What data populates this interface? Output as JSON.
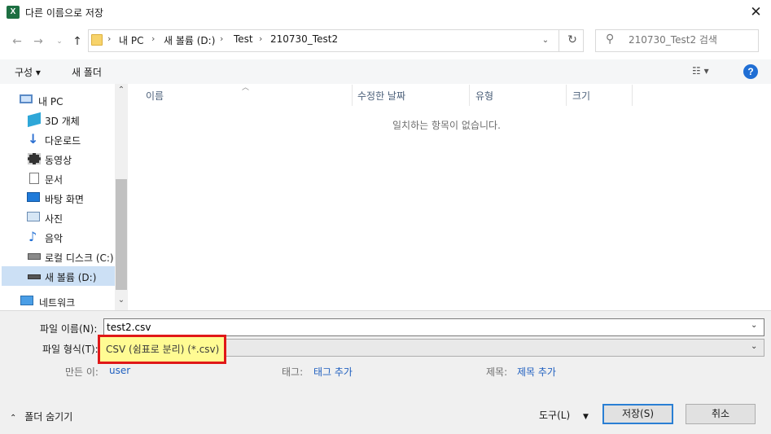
{
  "window": {
    "title": "다른 이름으로 저장",
    "app_icon": "X",
    "close_glyph": "✕"
  },
  "address": {
    "segments": [
      "내 PC",
      "새 볼륨 (D:)",
      "Test",
      "210730_Test2"
    ]
  },
  "search": {
    "placeholder": "210730_Test2 검색"
  },
  "toolbar": {
    "organize_label": "구성 ▾",
    "new_folder_label": "새 폴더",
    "view_label": "☷ ▾",
    "help_label": "?"
  },
  "nav": {
    "items": [
      {
        "label": "내 PC",
        "icon": "computer-icon",
        "selected": false
      },
      {
        "label": "3D 개체",
        "icon": "3d-objects-icon",
        "selected": false
      },
      {
        "label": "다운로드",
        "icon": "download-icon",
        "selected": false
      },
      {
        "label": "동영상",
        "icon": "video-icon",
        "selected": false
      },
      {
        "label": "문서",
        "icon": "document-icon",
        "selected": false
      },
      {
        "label": "바탕 화면",
        "icon": "desktop-icon",
        "selected": false
      },
      {
        "label": "사진",
        "icon": "picture-icon",
        "selected": false
      },
      {
        "label": "음악",
        "icon": "music-icon",
        "selected": false
      },
      {
        "label": "로컬 디스크 (C:)",
        "icon": "drive-icon",
        "selected": false
      },
      {
        "label": "새 볼륨 (D:)",
        "icon": "drive-icon",
        "selected": true
      },
      {
        "label": "네트워크",
        "icon": "network-icon",
        "selected": false
      }
    ]
  },
  "file_list": {
    "columns": [
      "이름",
      "수정한 날짜",
      "유형",
      "크기"
    ],
    "empty_message": "일치하는 항목이 없습니다."
  },
  "form": {
    "filename_label": "파일 이름(N):",
    "filename_value": "test2.csv",
    "filetype_label": "파일 형식(T):",
    "filetype_value": "CSV (쉼표로 분리) (*.csv)",
    "author_label": "만든 이:",
    "author_value": "user",
    "tags_label": "태그:",
    "tags_value": "태그 추가",
    "title_label": "제목:",
    "title_value": "제목 추가"
  },
  "footer": {
    "hide_folders_label": "폴더 숨기기",
    "tools_label": "도구(L)",
    "save_label": "저장(S)",
    "cancel_label": "취소"
  },
  "colors": {
    "highlight_border": "#e01818",
    "highlight_fill": "#fffb93",
    "accent": "#2a7fd4"
  }
}
